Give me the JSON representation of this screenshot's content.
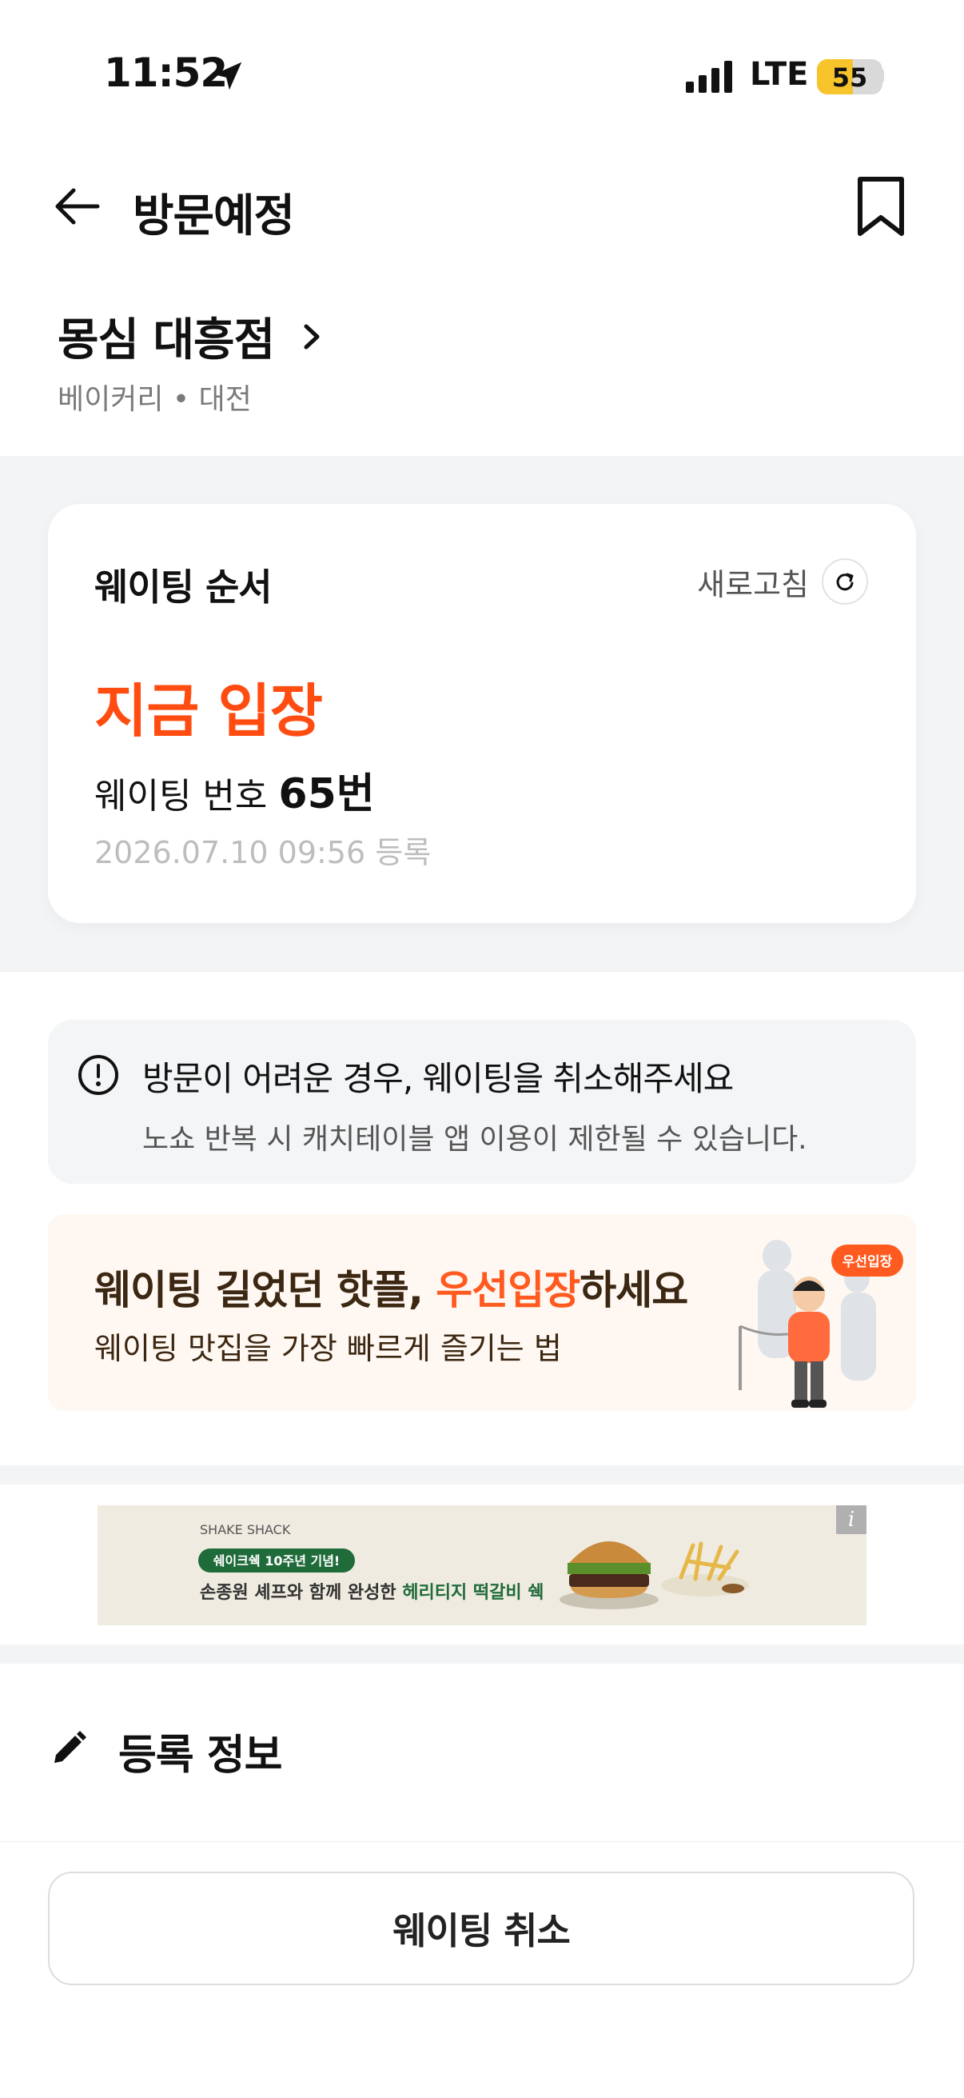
{
  "status_bar": {
    "time": "11:52",
    "network": "LTE",
    "battery_level": "55",
    "battery_fraction": 0.55
  },
  "header": {
    "title": "방문예정"
  },
  "store": {
    "name": "몽심 대흥점",
    "category": "베이커리 • 대전"
  },
  "waiting_card": {
    "title": "웨이팅 순서",
    "refresh_label": "새로고침",
    "status": "지금 입장",
    "number_label": "웨이팅 번호",
    "number_value": "65번",
    "registered_at": "2026.07.10 09:56 등록"
  },
  "notice": {
    "title": "방문이 어려운 경우, 웨이팅을 취소해주세요",
    "subtitle": "노쇼 반복 시 캐치테이블 앱 이용이 제한될 수 있습니다."
  },
  "promo": {
    "title_prefix": "웨이팅 길었던 핫플, ",
    "title_highlight": "우선입장",
    "title_suffix": "하세요",
    "subtitle": "웨이팅 맛집을 가장 빠르게 즐기는 법",
    "badge": "우선입장"
  },
  "ad": {
    "brand": "SHAKE SHACK",
    "tag": "쉐이크쉑 10주년 기념!",
    "text_prefix": "손종원 셰프와 함께 완성한 ",
    "text_highlight": "헤리티지 떡갈비 쉑",
    "info": "i"
  },
  "registration": {
    "title": "등록 정보"
  },
  "actions": {
    "cancel_label": "웨이팅 취소"
  },
  "colors": {
    "accent": "#ff4d12",
    "promo_bg": "#fff7f1",
    "promo_text": "#3b2712",
    "gray_bg": "#f3f4f6",
    "battery": "#f7c42b",
    "ad_green": "#1f6b3a"
  }
}
